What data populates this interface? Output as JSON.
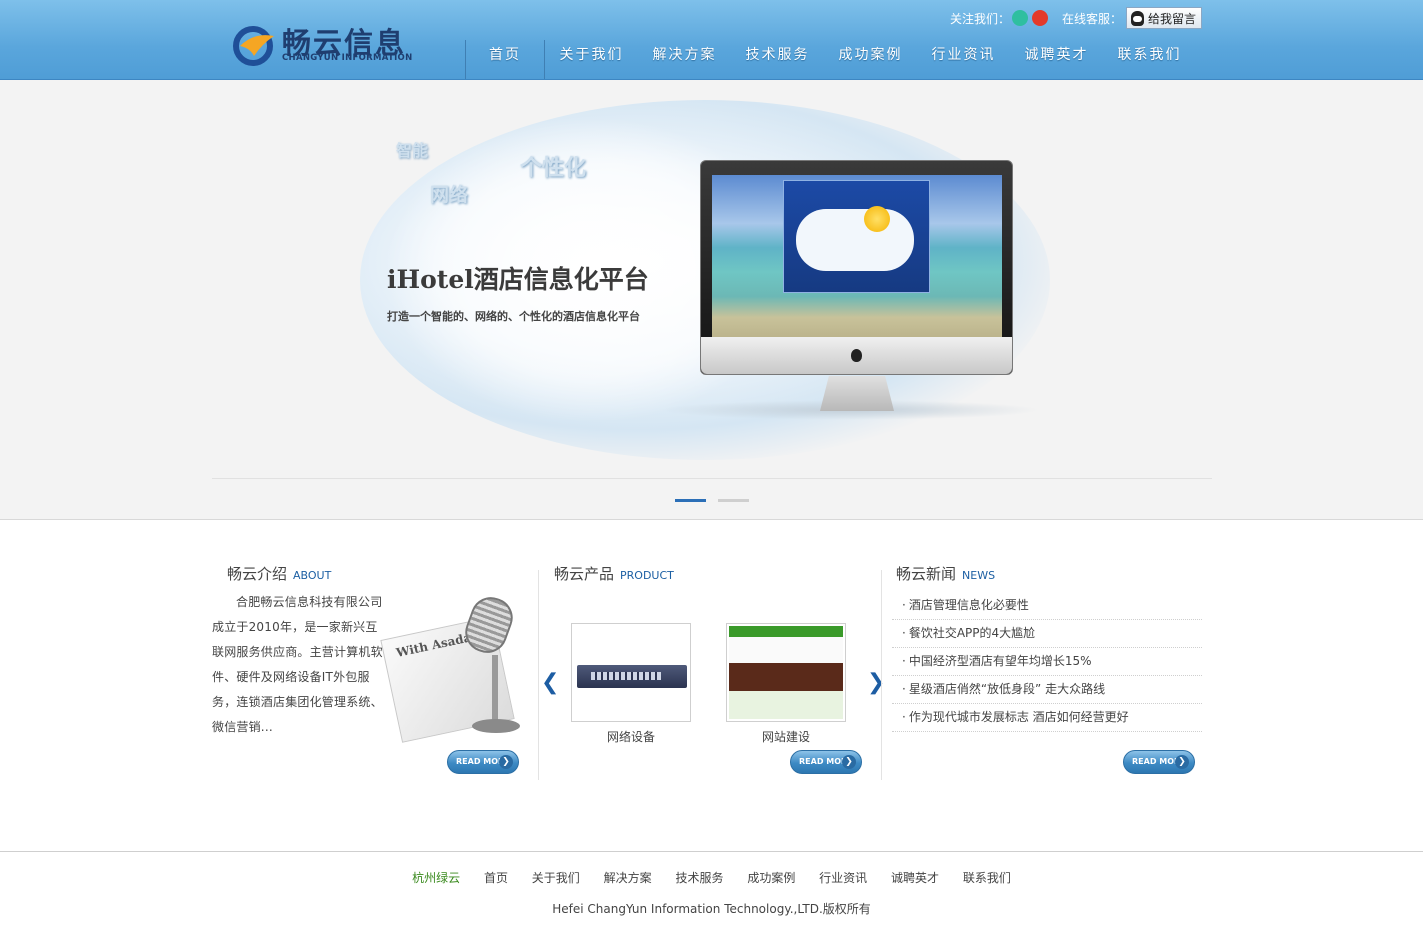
{
  "header": {
    "logo_text": "畅云信息",
    "logo_sub": "CHANGYUN INFORMATION",
    "follow_label": "关注我们：",
    "online_label": "在线客服：",
    "message_button": "给我留言",
    "nav": [
      "首页",
      "关于我们",
      "解决方案",
      "技术服务",
      "成功案例",
      "行业资讯",
      "诚聘英才",
      "联系我们"
    ]
  },
  "banner": {
    "words": [
      "智能",
      "网络",
      "个性化"
    ],
    "title": "iHotel酒店信息化平台",
    "subtitle": "打造一个智能的、网络的、个性化的酒店信息化平台",
    "active_slide": 1,
    "slide_count": 2
  },
  "about": {
    "title": "畅云介绍",
    "title_en": "ABOUT",
    "text": "合肥畅云信息科技有限公司成立于2010年，是一家新兴互联网服务供应商。主营计算机软件、硬件及网络设备IT外包服务，连锁酒店集团化管理系统、微信营销...",
    "image_caption": "With Asada",
    "read_more": "READ MORE"
  },
  "product": {
    "title": "畅云产品",
    "title_en": "PRODUCT",
    "items": [
      "网络设备",
      "网站建设"
    ],
    "read_more": "READ MORE"
  },
  "news": {
    "title": "畅云新闻",
    "title_en": "NEWS",
    "items": [
      "酒店管理信息化必要性",
      "餐饮社交APP的4大尴尬",
      "中国经济型酒店有望年均增长15%",
      "星级酒店俏然“放低身段” 走大众路线",
      "作为现代城市发展标志 酒店如何经营更好"
    ],
    "read_more": "READ MORE"
  },
  "footer": {
    "brand": "杭州绿云",
    "links": [
      "首页",
      "关于我们",
      "解决方案",
      "技术服务",
      "成功案例",
      "行业资讯",
      "诚聘英才",
      "联系我们"
    ],
    "copyright": "Hefei ChangYun Information Technology.,LTD.版权所有"
  },
  "colors": {
    "header": "#5aa6dc",
    "accent": "#1c5fa3",
    "footer_brand": "#3a8a1e"
  }
}
